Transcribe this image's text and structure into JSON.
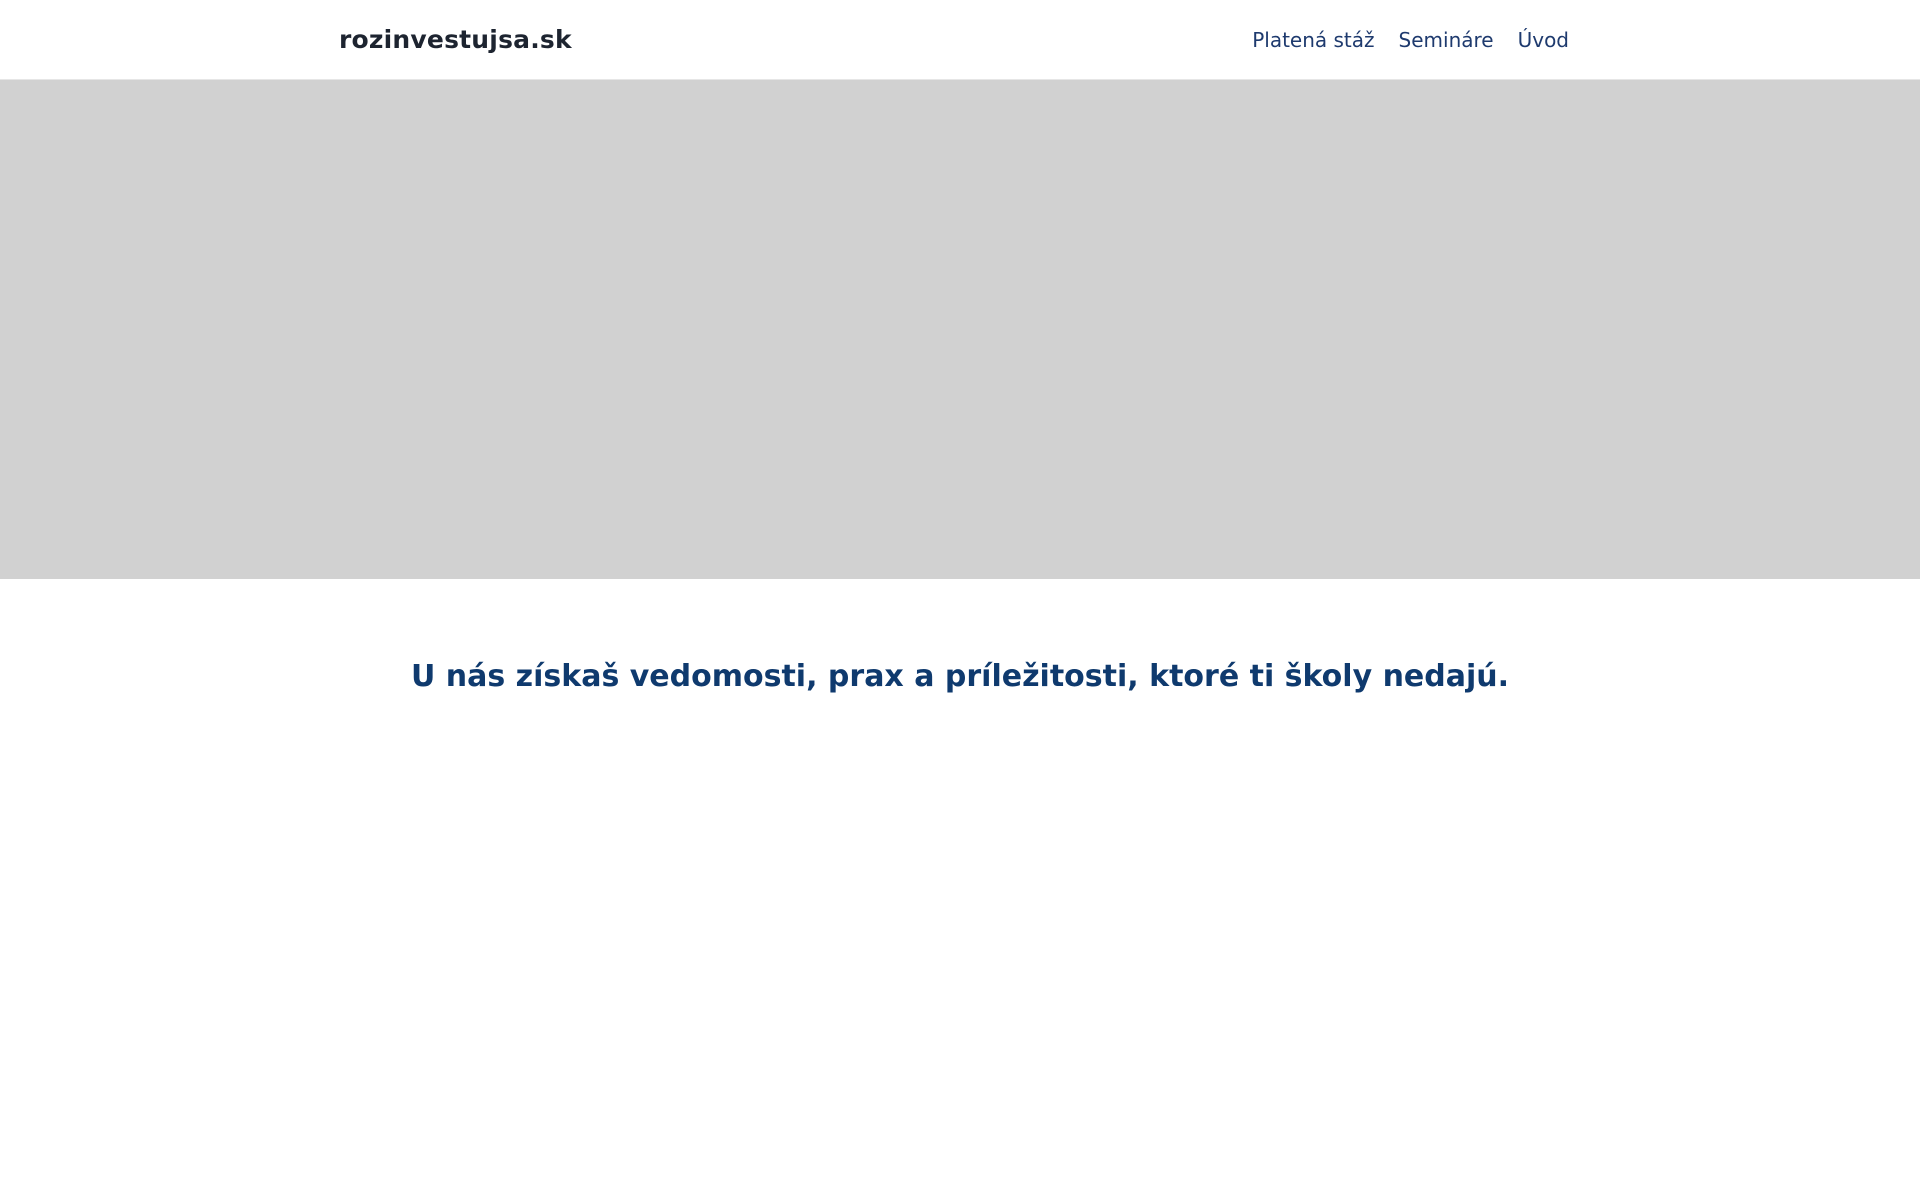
{
  "header": {
    "logo": "rozinvestujsa.sk",
    "nav": [
      {
        "label": "Platená stáž"
      },
      {
        "label": "Semináre"
      },
      {
        "label": "Úvod"
      }
    ]
  },
  "hero": {
    "background_color": "#d1d1d1"
  },
  "tagline": {
    "regular": "U nás získaš vedomosti, prax a príležitosti, ",
    "bold": "ktoré ti školy nedajú",
    "end": "."
  },
  "colors": {
    "logo_text": "#1d2430",
    "nav_text": "#1e3a6e",
    "tagline_text": "#0f3a6e"
  }
}
